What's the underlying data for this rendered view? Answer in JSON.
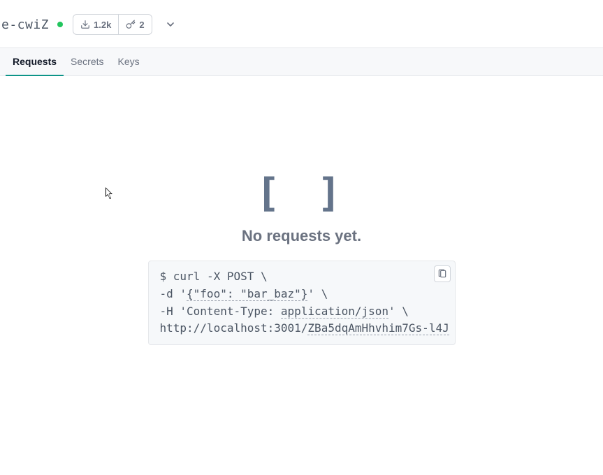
{
  "header": {
    "title_suffix": "e-cwiZ",
    "status": "online",
    "downloads": "1.2k",
    "keys": "2"
  },
  "tabs": [
    {
      "label": "Requests",
      "active": true
    },
    {
      "label": "Secrets",
      "active": false
    },
    {
      "label": "Keys",
      "active": false
    }
  ],
  "empty": {
    "brackets": "[ ]",
    "heading": "No requests yet.",
    "code": {
      "prompt": "$",
      "l1a": " curl -X POST \\",
      "l2a": "-d '",
      "l2b": "{\"foo\": \"bar_baz\"}",
      "l2c": "' \\",
      "l3a": "-H 'Content-Type: ",
      "l3b": "application/json",
      "l3c": "' \\",
      "l4a": "http://localhost:3001/",
      "l4b": "ZBa5dqAmHhvhim7Gs-l4J"
    }
  }
}
